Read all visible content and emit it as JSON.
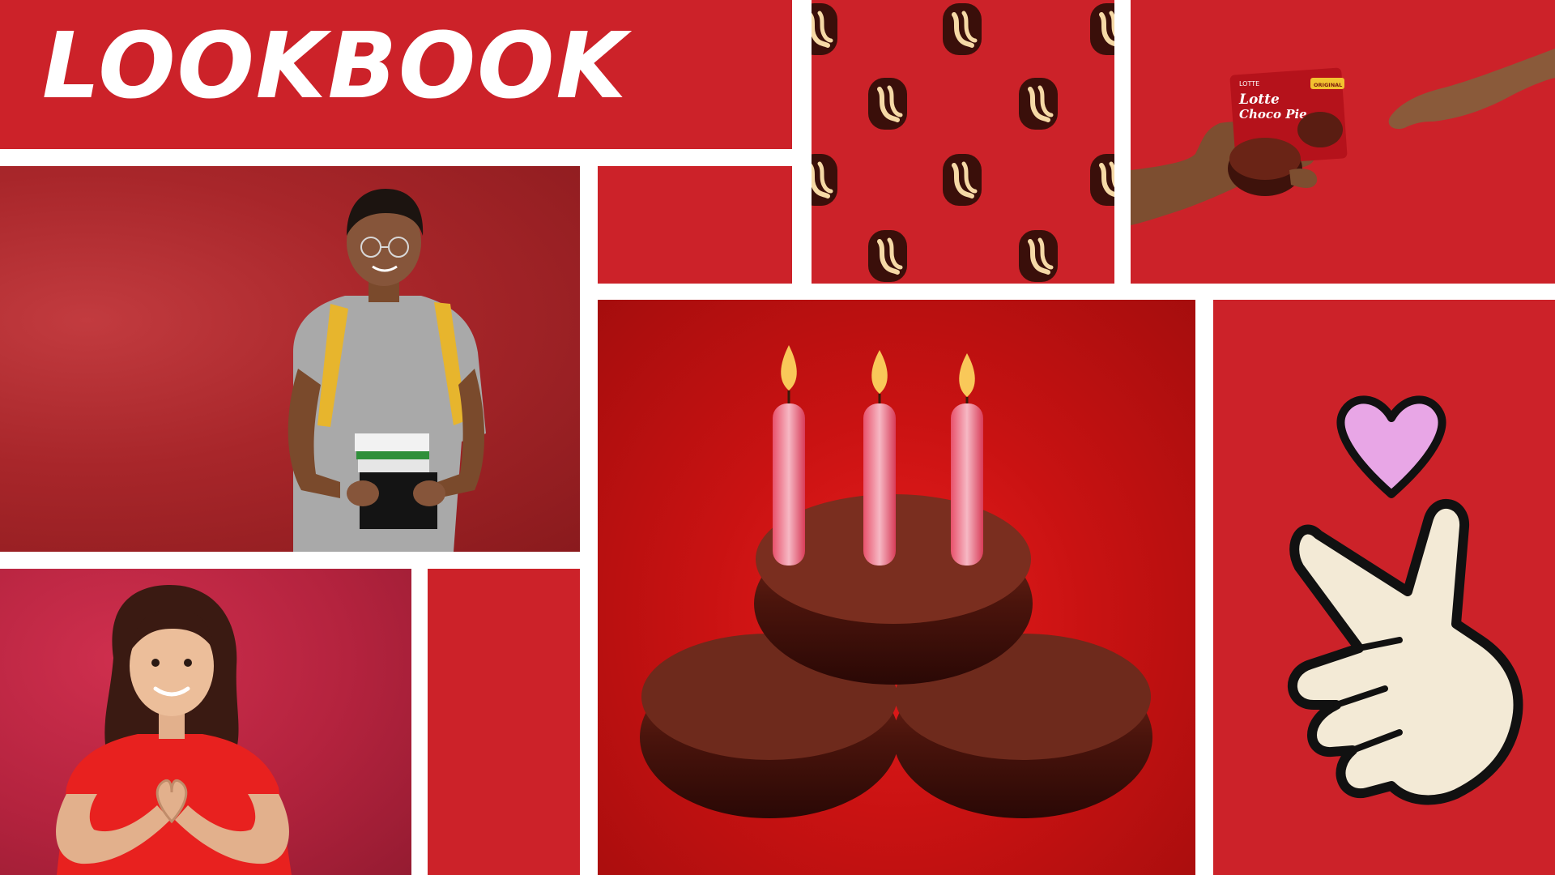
{
  "page": {
    "title": "LOOKBOOK"
  },
  "colors": {
    "brand_red": "#cc2229",
    "divider": "#ffffff",
    "title_text": "#ffffff",
    "chocolate": "#5a1d12",
    "candle_pink": "#e8516b",
    "heart_pink": "#e8a6e6",
    "hand_cream": "#f3ead6"
  },
  "product_pack": {
    "brand": "LOTTE",
    "name_line1": "Lotte",
    "name_line2": "Choco Pie",
    "badge": "ORIGINAL"
  },
  "icons": {
    "pattern": "choco-pie-icon",
    "finger_heart": "finger-heart-icon",
    "heart": "heart-icon",
    "candle": "candle-icon"
  }
}
